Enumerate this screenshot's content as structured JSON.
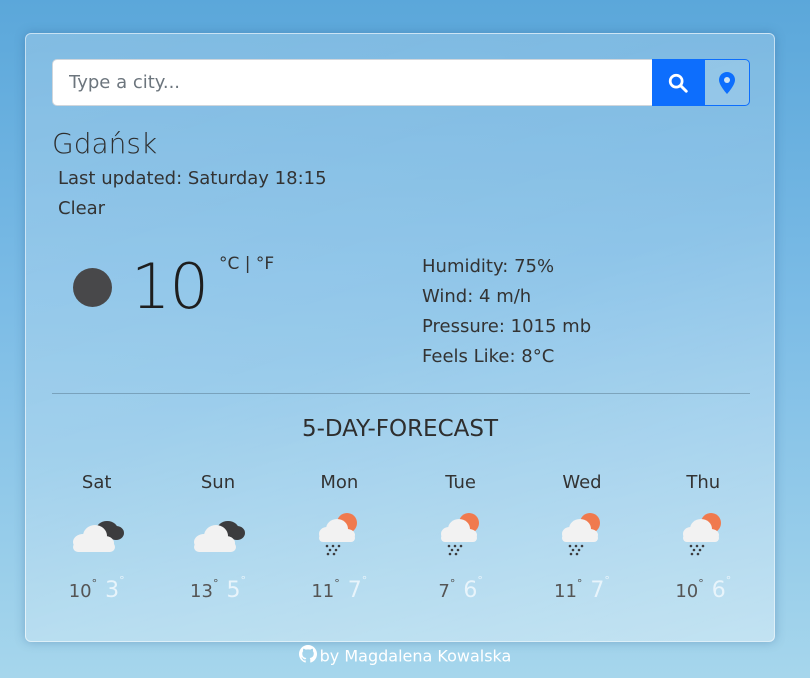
{
  "search": {
    "placeholder": "Type a city...",
    "value": ""
  },
  "icons": {
    "search": "search-icon",
    "location": "location-pin-icon",
    "current": "moon-icon",
    "github": "github-icon"
  },
  "colors": {
    "accent": "#0d6efd"
  },
  "weather": {
    "city": "Gdańsk",
    "last_updated": "Last updated: Saturday 18:15",
    "description": "Clear",
    "temperature": "10",
    "unit_celsius": "°C",
    "unit_separator": " | ",
    "unit_fahrenheit": "°F",
    "humidity": "Humidity: 75%",
    "wind": "Wind: 4 m/h",
    "pressure": "Pressure: 1015 mb",
    "feels_like": "Feels Like: 8°C"
  },
  "forecast": {
    "title": "5-DAY-FORECAST",
    "days": [
      {
        "name": "Sat",
        "icon": "cloudy-icon",
        "max": "10",
        "min": "3"
      },
      {
        "name": "Sun",
        "icon": "cloudy-icon",
        "max": "13",
        "min": "5"
      },
      {
        "name": "Mon",
        "icon": "sun-rain-icon",
        "max": "11",
        "min": "7"
      },
      {
        "name": "Tue",
        "icon": "sun-rain-icon",
        "max": "7",
        "min": "6"
      },
      {
        "name": "Wed",
        "icon": "sun-rain-icon",
        "max": "11",
        "min": "7"
      },
      {
        "name": "Thu",
        "icon": "sun-rain-icon",
        "max": "10",
        "min": "6"
      }
    ],
    "degree": "°"
  },
  "footer": {
    "text": "by Magdalena Kowalska"
  }
}
